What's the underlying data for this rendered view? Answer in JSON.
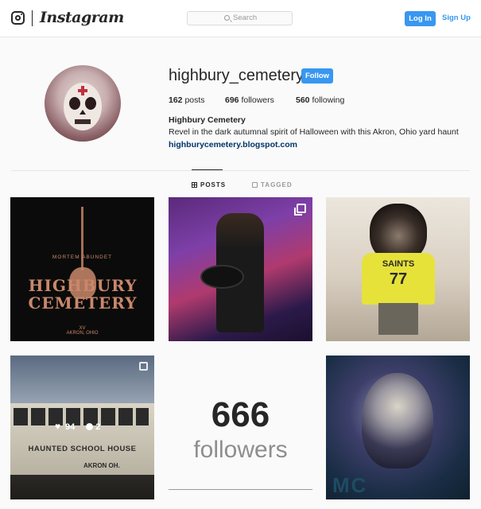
{
  "header": {
    "brand": "Instagram",
    "search_placeholder": "Search",
    "login_label": "Log In",
    "signup_label": "Sign Up",
    "accent_color": "#3897f0"
  },
  "profile": {
    "username": "highbury_cemetery",
    "follow_label": "Follow",
    "stats": {
      "posts_count": "162",
      "posts_label": "posts",
      "followers_count": "696",
      "followers_label": "followers",
      "following_count": "560",
      "following_label": "following"
    },
    "full_name": "Highbury Cemetery",
    "bio": "Revel in the dark autumnal spirit of Halloween with this Akron, Ohio yard haunt",
    "website": "highburycemetery.blogspot.com"
  },
  "tabs": [
    {
      "label": "POSTS",
      "icon": "grid-icon",
      "active": true
    },
    {
      "label": "TAGGED",
      "icon": "tag-icon",
      "active": false
    }
  ],
  "posts": [
    {
      "kind": "logo",
      "title_line1": "HIGHBURY",
      "title_line2": "CEMETERY",
      "subtitle": "MORTEM  ABUNDET",
      "footer_line1": "XV",
      "footer_line2": "AKRON, OHIO"
    },
    {
      "kind": "photo",
      "description_icon": "multiple-images-icon"
    },
    {
      "kind": "photo",
      "shirt_text": "SAINTS",
      "shirt_number": "77"
    },
    {
      "kind": "photo",
      "bus_text": "HAUNTED SCHOOL HOUSE",
      "bus_city": "AKRON OH.",
      "likes": "94",
      "comments": "2"
    },
    {
      "kind": "text",
      "number": "666",
      "word": "followers"
    },
    {
      "kind": "photo",
      "overlay_text": "MC"
    }
  ]
}
